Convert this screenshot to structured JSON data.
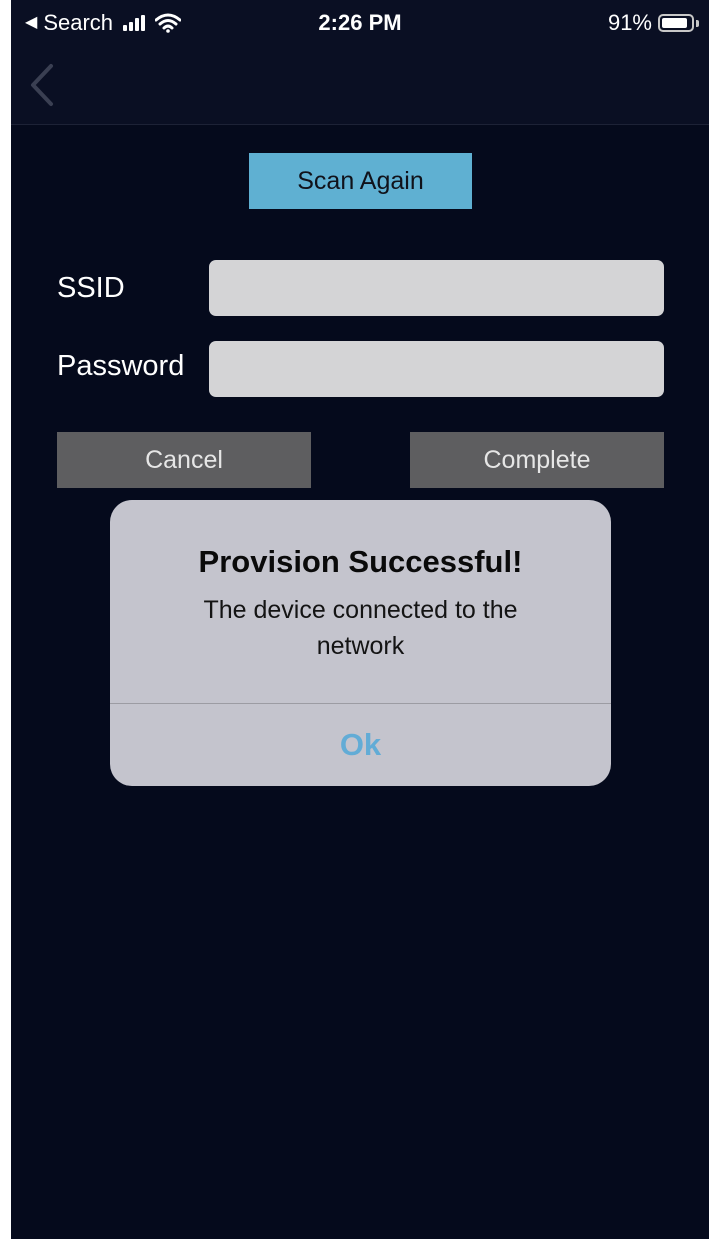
{
  "status_bar": {
    "back_app": "Search",
    "time": "2:26 PM",
    "battery_percent": "91%",
    "battery_level": 0.91
  },
  "nav": {
    "back_icon": "chevron-left-icon"
  },
  "form": {
    "scan_again_label": "Scan Again",
    "ssid_label": "SSID",
    "ssid_value": "",
    "password_label": "Password",
    "password_value": "",
    "cancel_label": "Cancel",
    "complete_label": "Complete"
  },
  "alert": {
    "title": "Provision Successful!",
    "message": "The device connected to the network",
    "ok_label": "Ok"
  },
  "colors": {
    "background": "#050a1c",
    "scan_button": "#5fb0d2",
    "gray_button": "#5e5e60",
    "alert_bg": "#c4c4cd",
    "alert_ok": "#62acd6"
  }
}
